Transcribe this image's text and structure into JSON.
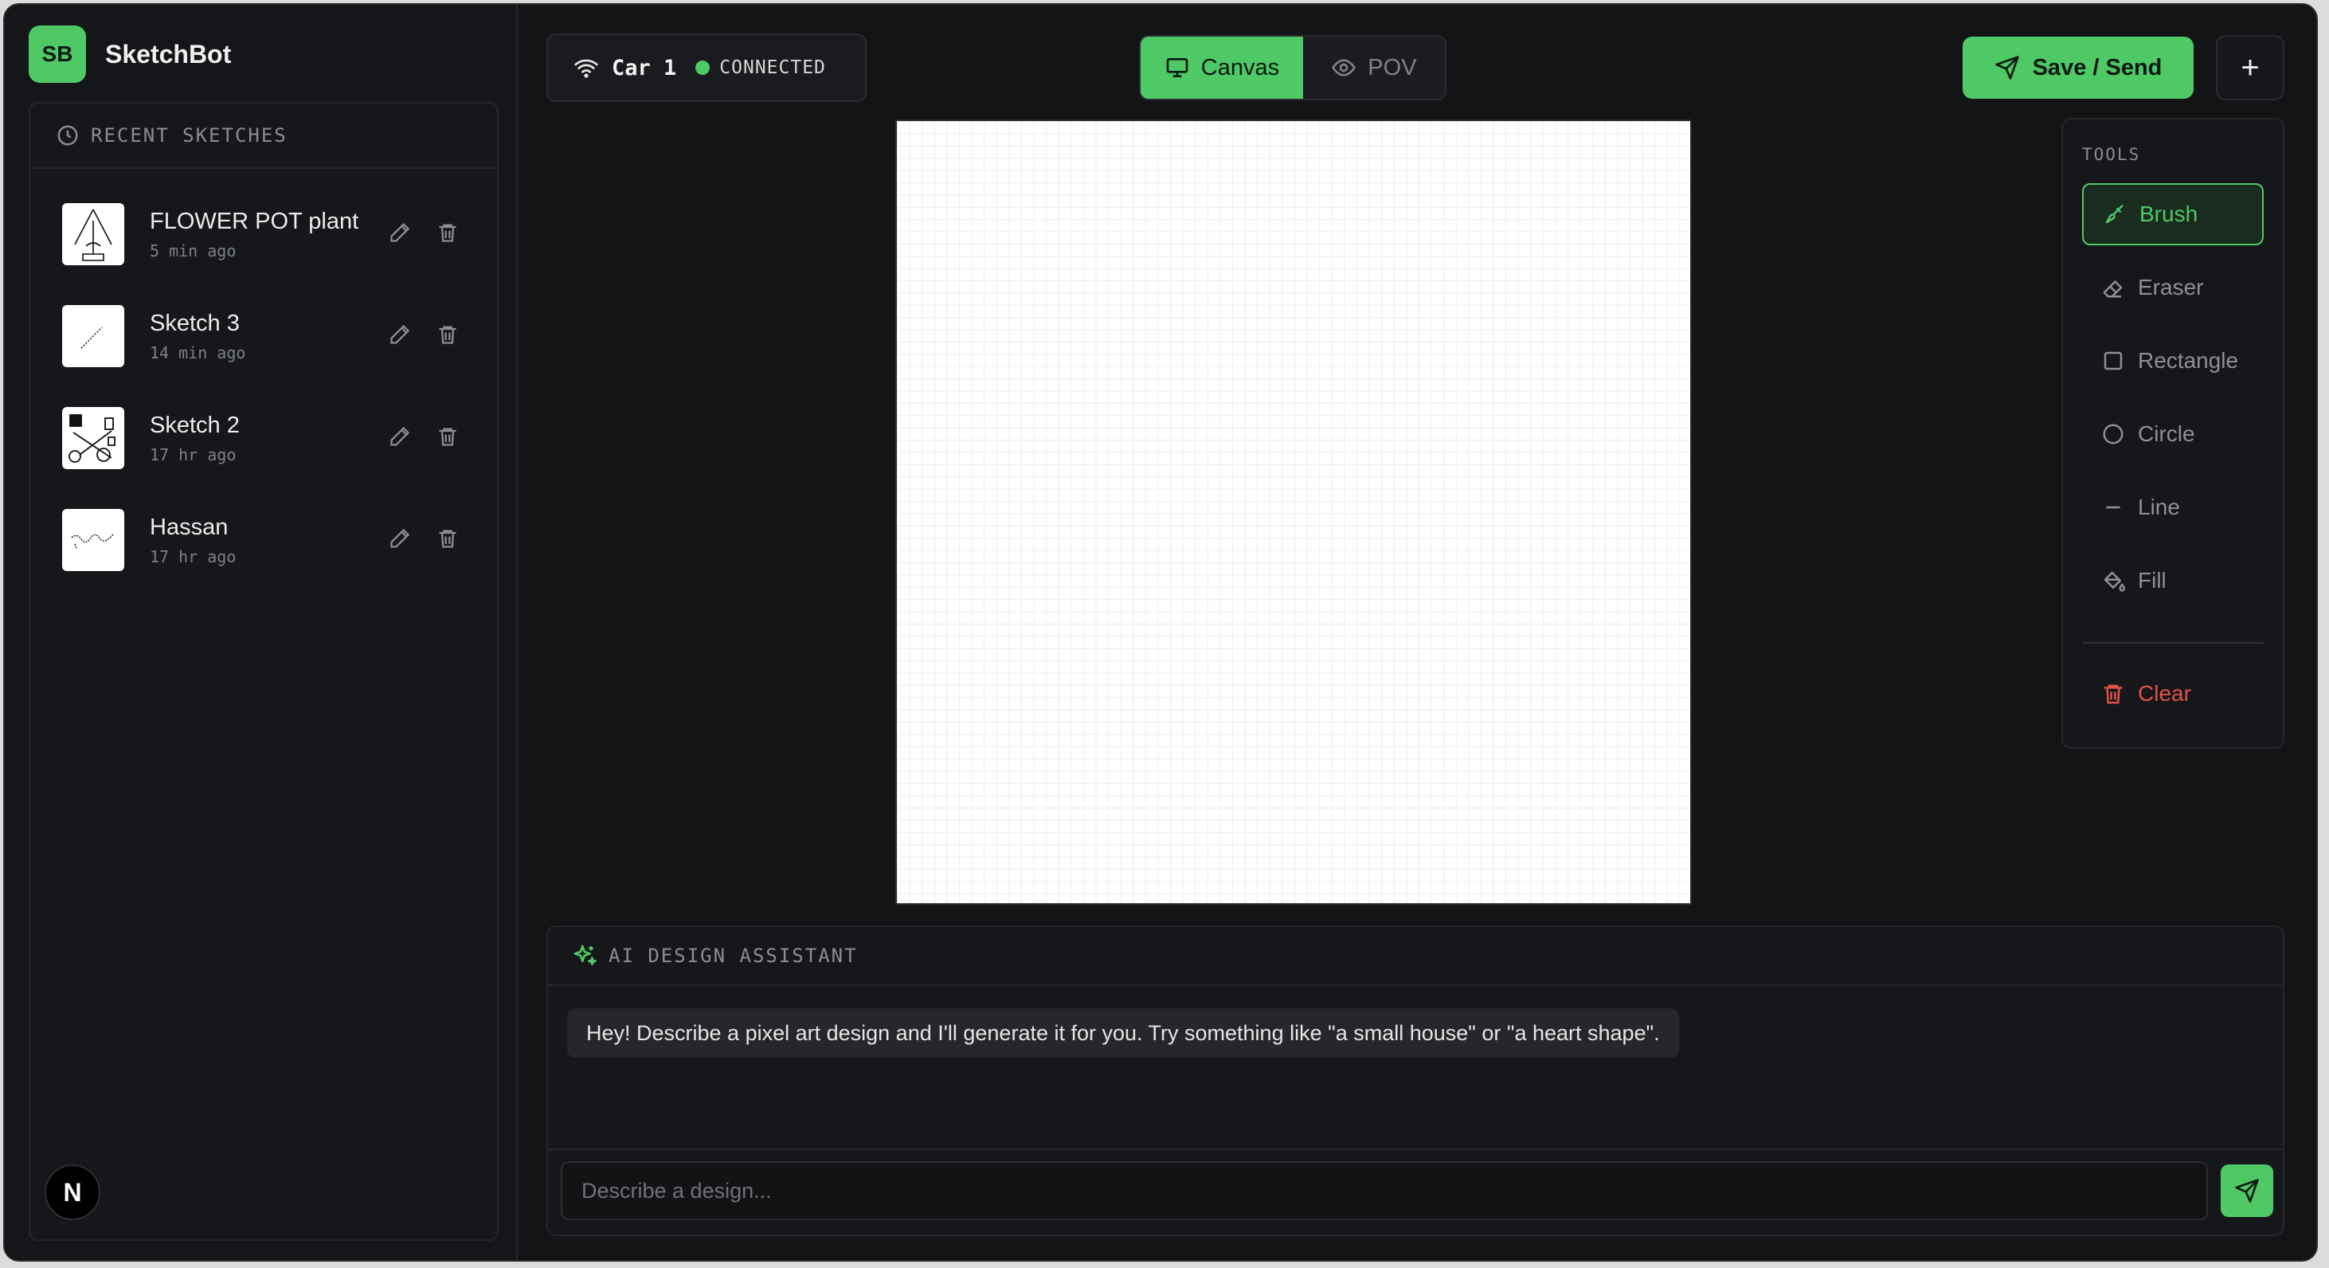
{
  "app": {
    "logo_text": "SB",
    "name": "SketchBot"
  },
  "sidebar": {
    "recent_title": "RECENT SKETCHES",
    "sketches": [
      {
        "name": "FLOWER POT plant",
        "time": "5 min ago"
      },
      {
        "name": "Sketch 3",
        "time": "14 min ago"
      },
      {
        "name": "Sketch 2",
        "time": "17 hr ago"
      },
      {
        "name": "Hassan",
        "time": "17 hr ago"
      }
    ],
    "user_avatar": "N"
  },
  "connection": {
    "car": "Car 1",
    "status": "CONNECTED",
    "status_color": "#4fc866"
  },
  "view_tabs": {
    "canvas": "Canvas",
    "pov": "POV",
    "active": "Canvas"
  },
  "actions": {
    "save_send": "Save / Send",
    "add": "+"
  },
  "tools": {
    "title": "TOOLS",
    "items": [
      "Brush",
      "Eraser",
      "Rectangle",
      "Circle",
      "Line",
      "Fill"
    ],
    "active": "Brush",
    "clear": "Clear"
  },
  "assistant": {
    "title": "AI DESIGN ASSISTANT",
    "message": "Hey! Describe a pixel art design and I'll generate it for you. Try something like \"a small house\" or \"a heart shape\".",
    "input_placeholder": "Describe a design..."
  },
  "colors": {
    "accent": "#4fc866",
    "danger": "#e05247",
    "background": "#131416"
  }
}
